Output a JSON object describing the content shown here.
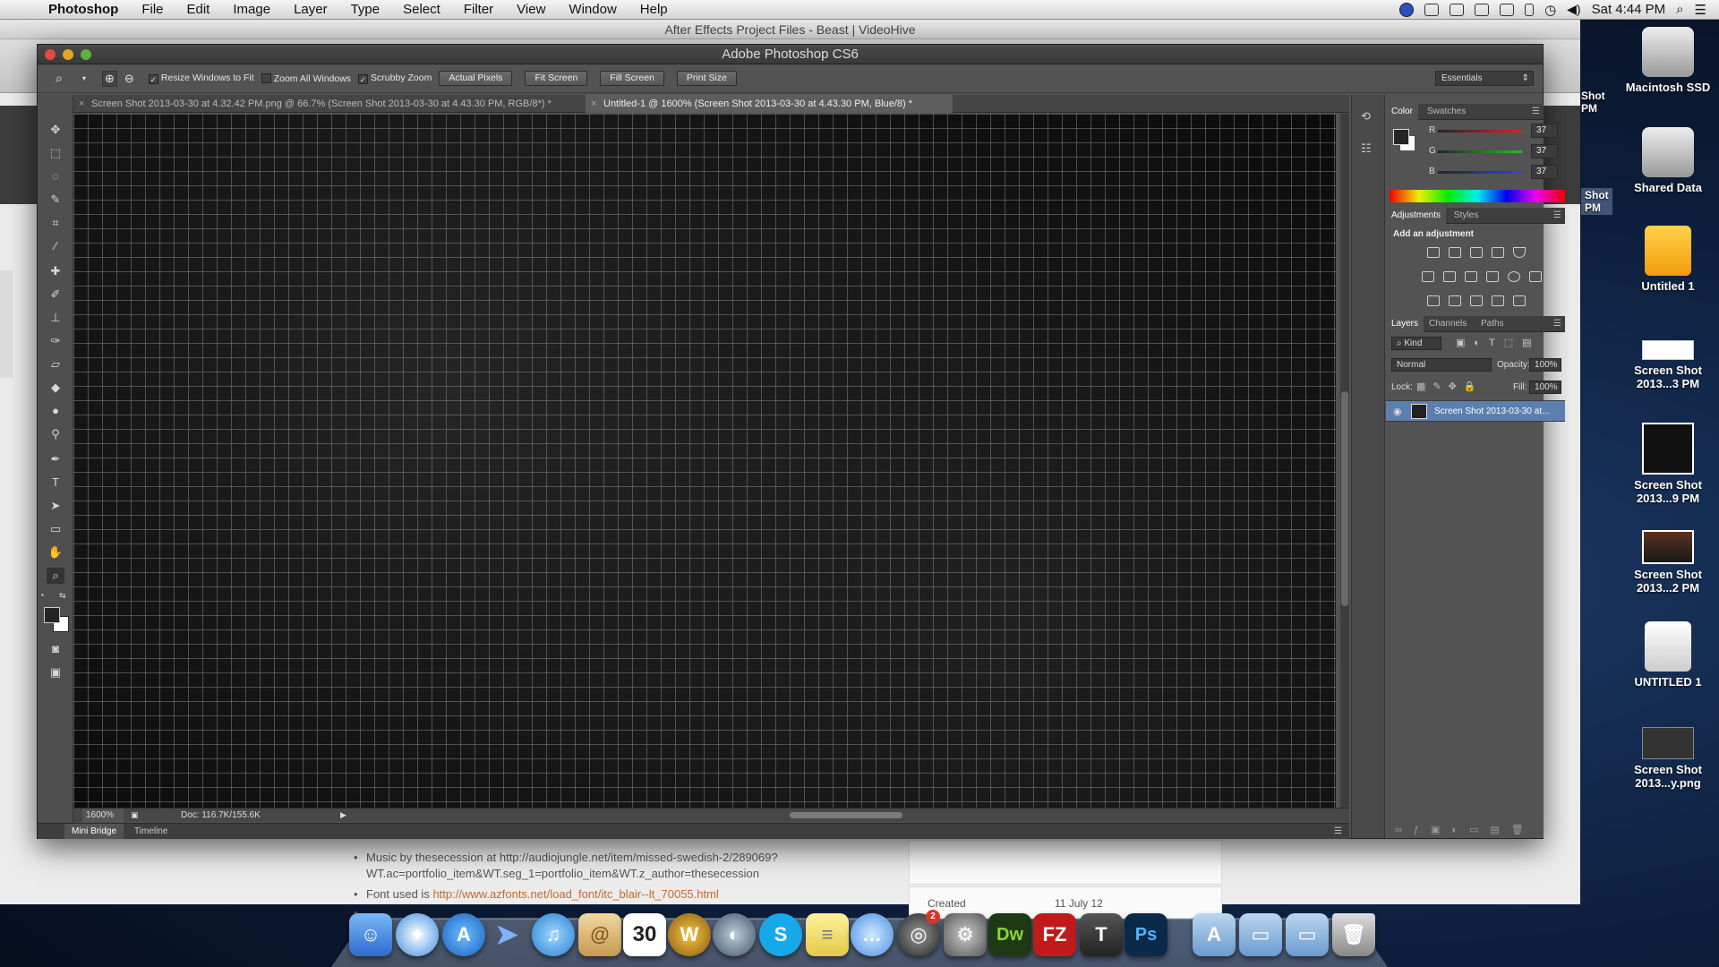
{
  "menubar": {
    "app": "Photoshop",
    "items": [
      "File",
      "Edit",
      "Image",
      "Layer",
      "Type",
      "Select",
      "Filter",
      "View",
      "Window",
      "Help"
    ],
    "clock": "Sat 4:44 PM"
  },
  "browser": {
    "title": "After Effects Project Files - Beast | VideoHive",
    "line1": "Music by thesecession at http://audiojungle.net/item/missed-swedish-2/289069?",
    "line2": "WT.ac=portfolio_item&WT.seg_1=portfolio_item&WT.z_author=thesecession",
    "font_label": "Font used is ",
    "font_link": "http://www.azfonts.net/load_font/itc_blair--lt_70055.html",
    "created_label": "Created",
    "created_value": "11 July 12"
  },
  "ps": {
    "title": "Adobe Photoshop CS6",
    "options": {
      "resize": "Resize Windows to Fit",
      "zoom_all": "Zoom All Windows",
      "scrubby": "Scrubby Zoom",
      "actual": "Actual Pixels",
      "fit": "Fit Screen",
      "fill": "Fill Screen",
      "print": "Print Size",
      "workspace": "Essentials"
    },
    "tabs": [
      "Screen Shot 2013-03-30 at 4.32.42 PM.png @ 66.7% (Screen Shot 2013-03-30 at 4.43.30 PM, RGB/8*) *",
      "Untitled-1 @ 1600% (Screen Shot 2013-03-30 at 4.43.30 PM, Blue/8) *"
    ],
    "status": {
      "zoom": "1600%",
      "doc": "Doc: 116.7K/155.6K"
    },
    "bottom_tabs": [
      "Mini Bridge",
      "Timeline"
    ]
  },
  "panels": {
    "color_tabs": [
      "Color",
      "Swatches"
    ],
    "rgb": [
      {
        "label": "R",
        "value": "37"
      },
      {
        "label": "G",
        "value": "37"
      },
      {
        "label": "B",
        "value": "37"
      }
    ],
    "adj_tabs": [
      "Adjustments",
      "Styles"
    ],
    "adj_title": "Add an adjustment",
    "layer_tabs": [
      "Layers",
      "Channels",
      "Paths"
    ],
    "kind": "Kind",
    "blend": "Normal",
    "opacity_label": "Opacity:",
    "opacity": "100%",
    "lock_label": "Lock:",
    "fill_label": "Fill:",
    "fill": "100%",
    "layer_name": "Screen Shot 2013-03-30 at..."
  },
  "desktop": {
    "icons": [
      "Macintosh SSD",
      "Shared Data",
      "Untitled 1",
      "Screen Shot 2013...3 PM",
      "Screen Shot 2013...9 PM",
      "Screen Shot 2013...2 PM",
      "UNTITLED 1",
      "Screen Shot 2013...y.png"
    ],
    "partial": [
      "Shot",
      "PM",
      "Shot",
      "PM"
    ]
  },
  "dock": {
    "calendar_day": "30",
    "badge": "2"
  }
}
